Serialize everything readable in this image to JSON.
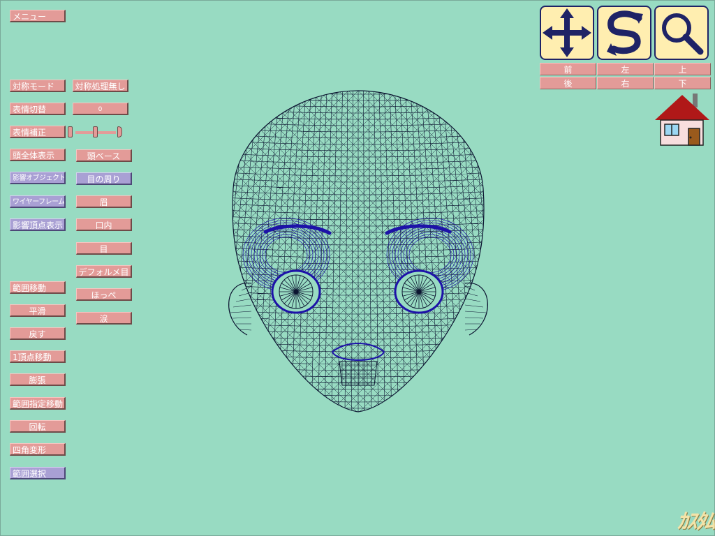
{
  "menu": {
    "label": "メニュー"
  },
  "left_column": [
    {
      "id": "symmetry-mode",
      "label": "対称モード"
    },
    {
      "id": "expression-switch",
      "label": "表情切替"
    },
    {
      "id": "expression-correction",
      "label": "表情補正"
    },
    {
      "id": "head-whole-display",
      "label": "頭全体表示"
    },
    {
      "id": "affected-object-select",
      "label": "影響オブジェクト選択",
      "selected": true
    },
    {
      "id": "wireframe-display",
      "label": "ワイヤーフレーム表示",
      "selected": true
    },
    {
      "id": "affected-vertex-display",
      "label": "影響頂点表示",
      "selected": true
    },
    {
      "id": "range-move",
      "label": "範囲移動"
    },
    {
      "id": "smooth",
      "label": "平滑"
    },
    {
      "id": "undo",
      "label": "戻す"
    },
    {
      "id": "one-vertex-move",
      "label": "1頂点移動"
    },
    {
      "id": "inflate",
      "label": "膨張"
    },
    {
      "id": "range-specified-move",
      "label": "範囲指定移動"
    },
    {
      "id": "rotate",
      "label": "回転"
    },
    {
      "id": "quad-deform",
      "label": "四角変形"
    },
    {
      "id": "range-select",
      "label": "範囲選択",
      "selected": true
    }
  ],
  "right_column": {
    "symmetry_value": "対称処理無し",
    "expression_value": "0",
    "expression_slider": {
      "value_fraction": 0.48
    },
    "parts": [
      {
        "id": "head-base",
        "label": "頭ベース"
      },
      {
        "id": "around-eyes",
        "label": "目の周り",
        "selected": true
      },
      {
        "id": "eyebrow",
        "label": "眉"
      },
      {
        "id": "mouth-inside",
        "label": "口内"
      },
      {
        "id": "eye",
        "label": "目"
      },
      {
        "id": "deformed-eye",
        "label": "デフォルメ目"
      },
      {
        "id": "cheek",
        "label": "ほっぺ"
      },
      {
        "id": "tears",
        "label": "涙"
      }
    ]
  },
  "view_tools": {
    "icons": [
      "move-arrows-icon",
      "rotate-icon",
      "magnify-icon"
    ],
    "directions": [
      [
        "前",
        "左",
        "上"
      ],
      [
        "後",
        "右",
        "下"
      ]
    ]
  },
  "home": {
    "icon": "home-icon"
  },
  "logo": {
    "text": "ｶｽﾀﾑ"
  },
  "colors": {
    "background": "#98dbc2",
    "button": "#e39b98",
    "button_selected": "#a9a0d4",
    "wire": "#0b1430",
    "wire_highlight": "#1d12a8"
  }
}
